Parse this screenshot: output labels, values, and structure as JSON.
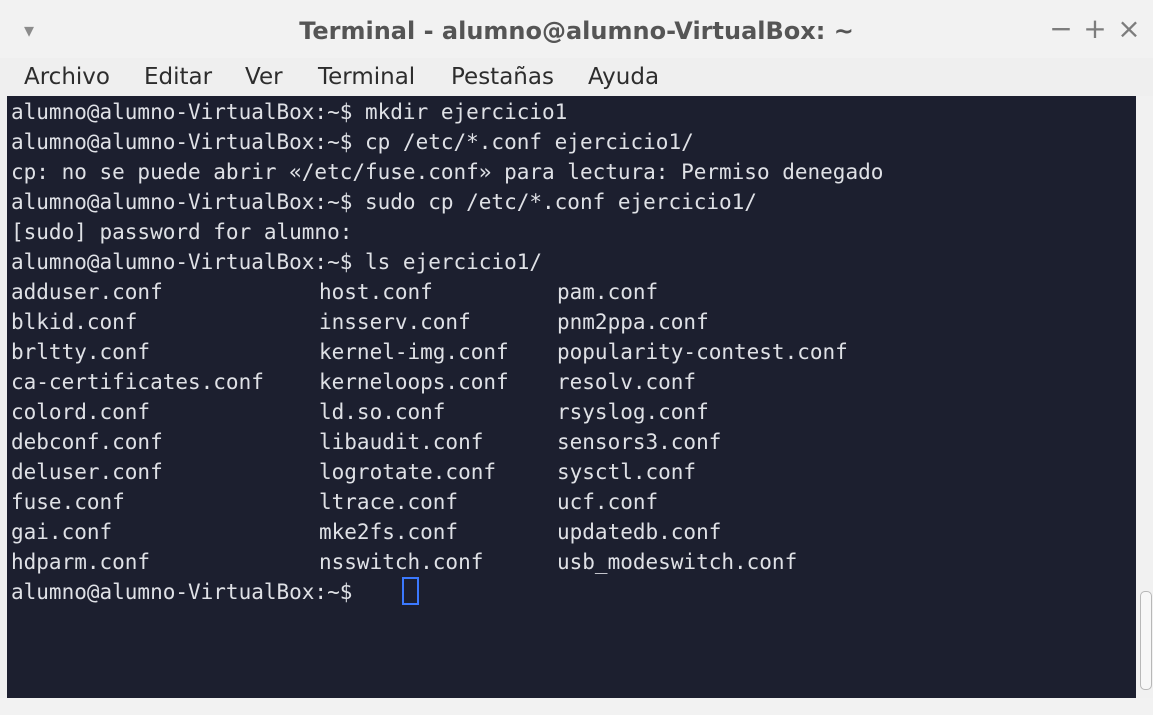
{
  "window": {
    "title": "Terminal - alumno@alumno-VirtualBox: ~",
    "menu_icon": "▾",
    "controls": {
      "minimize": "−",
      "maximize": "+",
      "close": "×"
    }
  },
  "menubar": {
    "items": [
      "Archivo",
      "Editar",
      "Ver",
      "Terminal",
      "Pestañas",
      "Ayuda"
    ]
  },
  "terminal": {
    "lines": [
      "alumno@alumno-VirtualBox:~$ mkdir ejercicio1",
      "alumno@alumno-VirtualBox:~$ cp /etc/*.conf ejercicio1/",
      "cp: no se puede abrir «/etc/fuse.conf» para lectura: Permiso denegado",
      "alumno@alumno-VirtualBox:~$ sudo cp /etc/*.conf ejercicio1/",
      "[sudo] password for alumno:",
      "alumno@alumno-VirtualBox:~$ ls ejercicio1/"
    ],
    "columns": [
      [
        "adduser.conf",
        "blkid.conf",
        "brltty.conf",
        "ca-certificates.conf",
        "colord.conf",
        "debconf.conf",
        "deluser.conf",
        "fuse.conf",
        "gai.conf",
        "hdparm.conf"
      ],
      [
        "host.conf",
        "insserv.conf",
        "kernel-img.conf",
        "kerneloops.conf",
        "ld.so.conf",
        "libaudit.conf",
        "logrotate.conf",
        "ltrace.conf",
        "mke2fs.conf",
        "nsswitch.conf"
      ],
      [
        "pam.conf",
        "pnm2ppa.conf",
        "popularity-contest.conf",
        "resolv.conf",
        "rsyslog.conf",
        "sensors3.conf",
        "sysctl.conf",
        "ucf.conf",
        "updatedb.conf",
        "usb_modeswitch.conf"
      ]
    ],
    "prompt": "alumno@alumno-VirtualBox:~$ "
  }
}
